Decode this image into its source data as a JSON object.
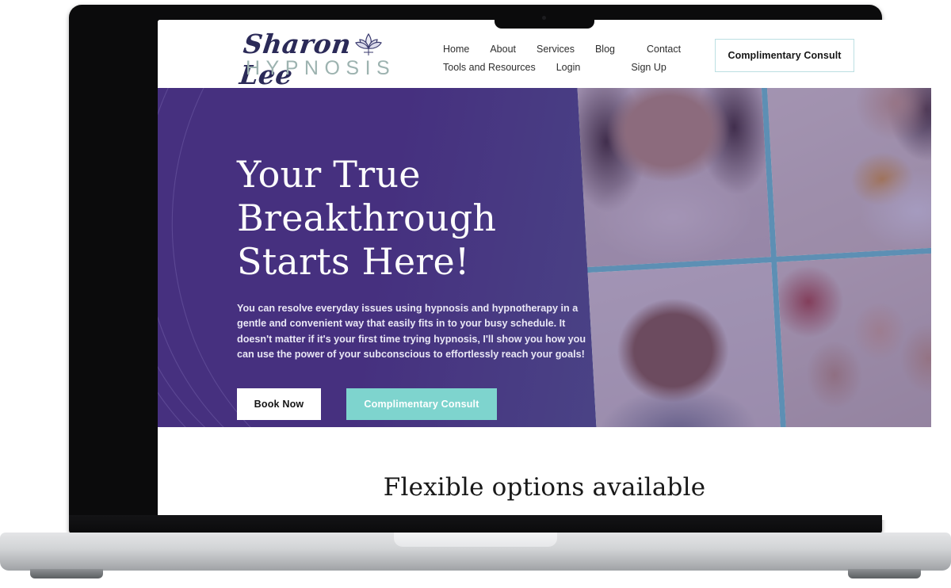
{
  "device": {
    "type": "laptop-mockup",
    "notch_label": "camera-notch"
  },
  "site": {
    "logo": {
      "script_text": "Sharon Lee",
      "subtitle_text": "HYPNOSIS",
      "icon": "lotus-icon",
      "script_color": "#2b2a58",
      "subtitle_color": "#9db3b0"
    },
    "nav": {
      "row1": [
        {
          "label": "Home"
        },
        {
          "label": "About"
        },
        {
          "label": "Services"
        },
        {
          "label": "Blog"
        },
        {
          "label": "Contact"
        }
      ],
      "row2": [
        {
          "label": "Tools and Resources"
        },
        {
          "label": "Login"
        },
        {
          "label": "Sign Up"
        }
      ],
      "cta": {
        "label": "Complimentary Consult",
        "border_color": "#bcdfe2"
      }
    },
    "hero": {
      "title_line1": "Your True Breakthrough",
      "title_line2": "Starts Here!",
      "paragraph": "You can resolve everyday issues using hypnosis and hypnotherapy in a gentle and convenient way that easily fits in to your busy schedule. It doesn't matter if it's your first time trying hypnosis, I'll show you how you can use the power of your subconscious to effortlessly reach your goals!",
      "buttons": [
        {
          "label": "Book Now",
          "style": "white",
          "color": "#ffffff"
        },
        {
          "label": "Complimentary Consult",
          "style": "teal",
          "color": "#7ed4ce"
        }
      ],
      "gradient_start": "#46307f",
      "gradient_end": "#4c5189",
      "collage": {
        "name": "photo-collage",
        "tiles": [
          {
            "alt": "smiling-woman-curly-hair"
          },
          {
            "alt": "smiling-woman-at-laptop"
          },
          {
            "alt": "smiling-man-hand-on-chin"
          },
          {
            "alt": "group-of-friends-laughing"
          }
        ],
        "divider_color": "#5d8fb4"
      }
    },
    "below_hero": {
      "heading": "Flexible options available"
    }
  }
}
